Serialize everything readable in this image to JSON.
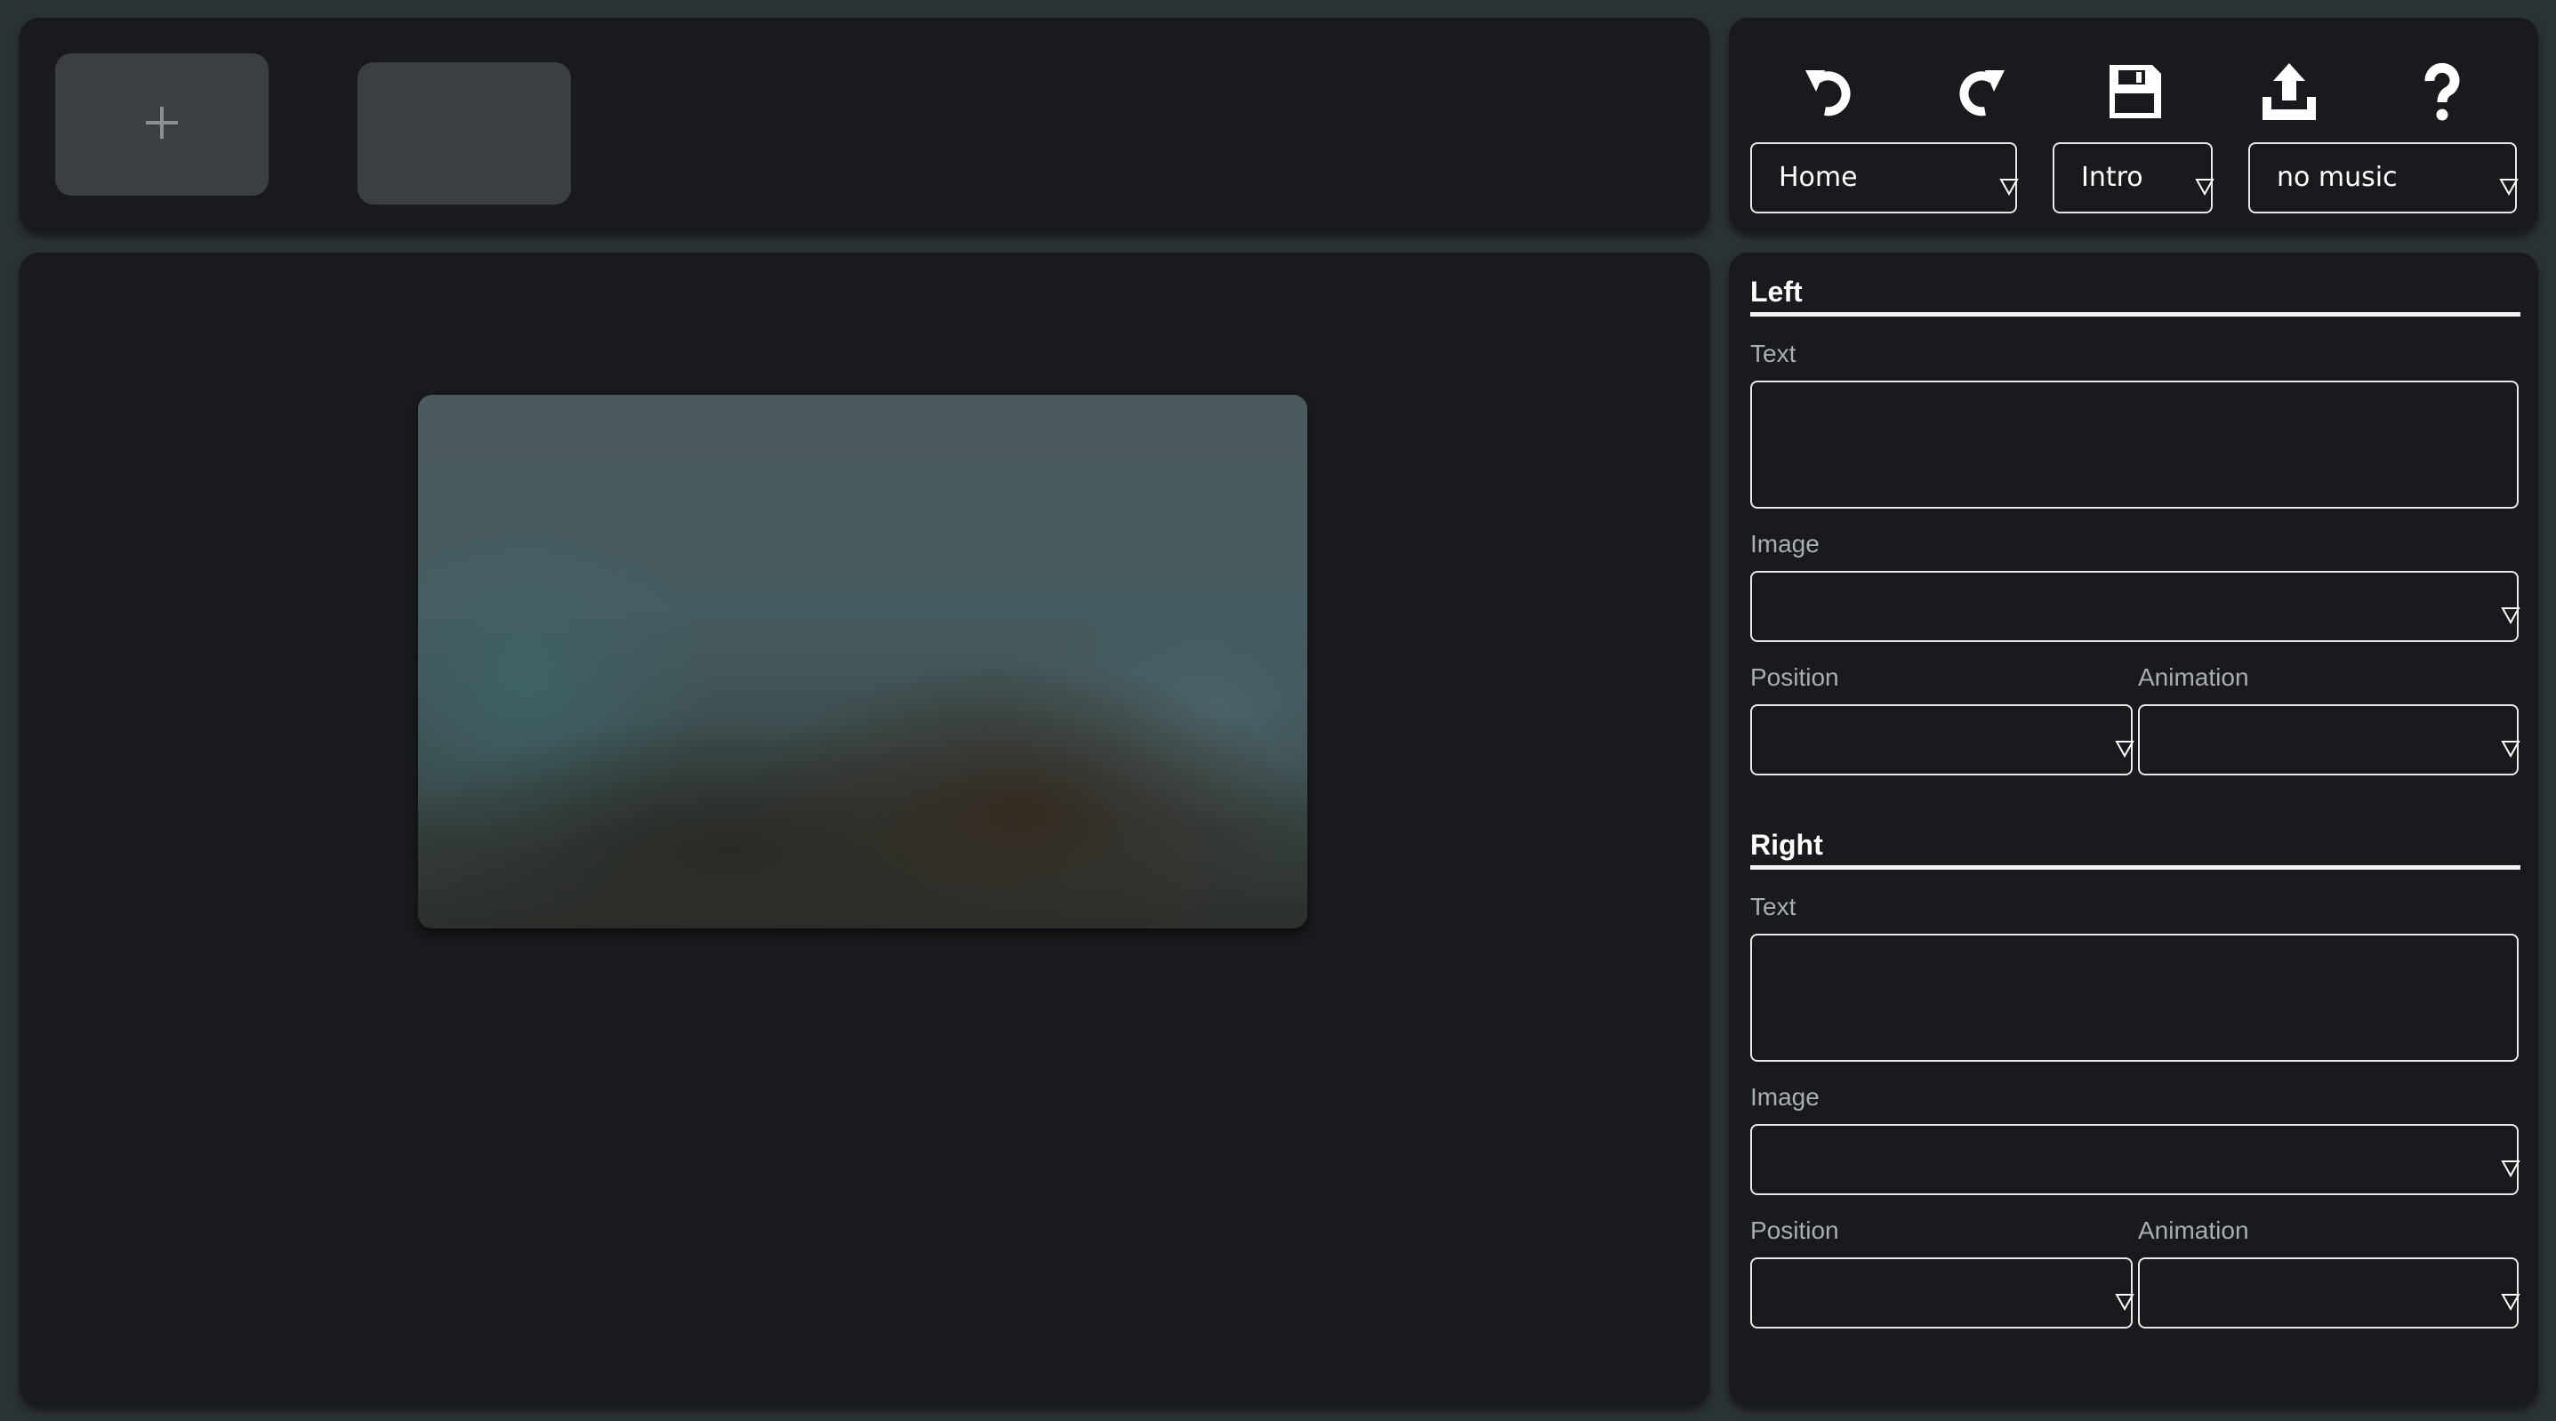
{
  "slides_bar": {
    "add_icon": "plus-icon",
    "thumbnails": [
      {
        "label": ""
      }
    ]
  },
  "toolbar": {
    "undo_icon": "undo-icon",
    "redo_icon": "redo-icon",
    "save_icon": "save-icon",
    "export_icon": "export-icon",
    "help_icon": "help-icon",
    "page_select": {
      "value": "Home"
    },
    "slide_select": {
      "value": "Intro"
    },
    "music_select": {
      "value": "no music"
    }
  },
  "editor": {
    "left": {
      "heading": "Left",
      "text_label": "Text",
      "text_value": "",
      "image_label": "Image",
      "image_value": "",
      "position_label": "Position",
      "position_value": "",
      "animation_label": "Animation",
      "animation_value": ""
    },
    "right": {
      "heading": "Right",
      "text_label": "Text",
      "text_value": "",
      "image_label": "Image",
      "image_value": "",
      "position_label": "Position",
      "position_value": "",
      "animation_label": "Animation",
      "animation_value": ""
    }
  },
  "colors": {
    "background": "#2c3337",
    "panel": "#181a1d",
    "thumbnail": "#3a3f43",
    "border": "#e8e8e8",
    "label": "#a9aeb2"
  }
}
